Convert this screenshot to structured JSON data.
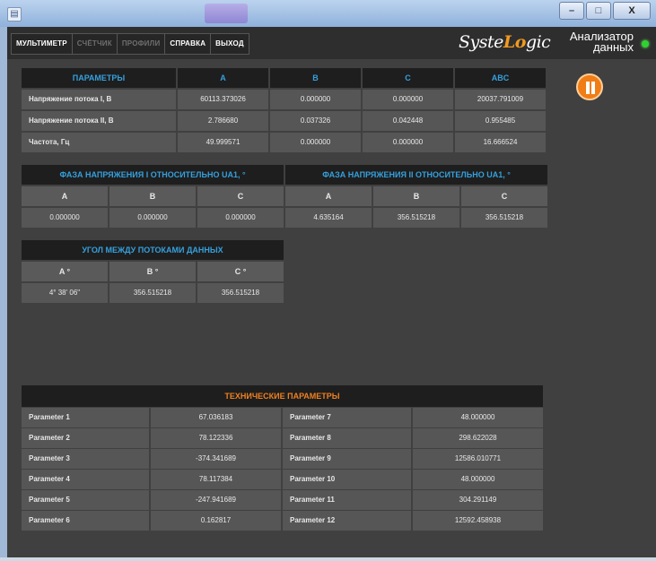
{
  "window": {
    "app_icon": "app-icon",
    "buttons": [
      "–",
      "□",
      "X"
    ]
  },
  "menu": [
    {
      "label": "МУЛЬТИМЕТР",
      "active": true
    },
    {
      "label": "СЧЁТЧИК",
      "active": false
    },
    {
      "label": "ПРОФИЛИ",
      "active": false
    },
    {
      "label": "СПРАВКА",
      "active": true
    },
    {
      "label": "ВЫХОД",
      "active": true
    }
  ],
  "logo": {
    "prefix": "Syste",
    "mark": "Lo",
    "suffix": "gic"
  },
  "app_title": "Анализатор данных",
  "status_color": "#2fd12f",
  "params": {
    "headers": [
      "ПАРАМЕТРЫ",
      "A",
      "B",
      "C",
      "ABC"
    ],
    "rows": [
      [
        "Напряжение потока I, В",
        "60113.373026",
        "0.000000",
        "0.000000",
        "20037.791009"
      ],
      [
        "Напряжение потока II, В",
        "2.786680",
        "0.037326",
        "0.042448",
        "0.955485"
      ],
      [
        "Частота, Гц",
        "49.999571",
        "0.000000",
        "0.000000",
        "16.666524"
      ]
    ]
  },
  "phase1": {
    "title": "ФАЗА НАПРЯЖЕНИЯ I ОТНОСИТЕЛЬНО UA1, °",
    "headers": [
      "A",
      "B",
      "C"
    ],
    "values": [
      "0.000000",
      "0.000000",
      "0.000000"
    ]
  },
  "phase2": {
    "title": "ФАЗА НАПРЯЖЕНИЯ II ОТНОСИТЕЛЬНО UA1, °",
    "headers": [
      "A",
      "B",
      "C"
    ],
    "values": [
      "4.635164",
      "356.515218",
      "356.515218"
    ]
  },
  "angle": {
    "title": "УГОЛ МЕЖДУ ПОТОКАМИ ДАННЫХ",
    "headers": [
      "A °",
      "B °",
      "C °"
    ],
    "values": [
      "4° 38' 06\"",
      "356.515218",
      "356.515218"
    ]
  },
  "tech": {
    "title": "ТЕХНИЧЕСКИЕ ПАРАМЕТРЫ",
    "rows": [
      [
        "Parameter 1",
        "67.036183",
        "Parameter 7",
        "48.000000"
      ],
      [
        "Parameter 2",
        "78.122336",
        "Parameter 8",
        "298.622028"
      ],
      [
        "Parameter 3",
        "-374.341689",
        "Parameter 9",
        "12586.010771"
      ],
      [
        "Parameter 4",
        "78.117384",
        "Parameter 10",
        "48.000000"
      ],
      [
        "Parameter 5",
        "-247.941689",
        "Parameter 11",
        "304.291149"
      ],
      [
        "Parameter 6",
        "0.162817",
        "Parameter 12",
        "12592.458938"
      ]
    ]
  },
  "colors": {
    "accent_blue": "#35a0dd",
    "accent_orange": "#ef8020",
    "pause_button": "#f07d16"
  }
}
